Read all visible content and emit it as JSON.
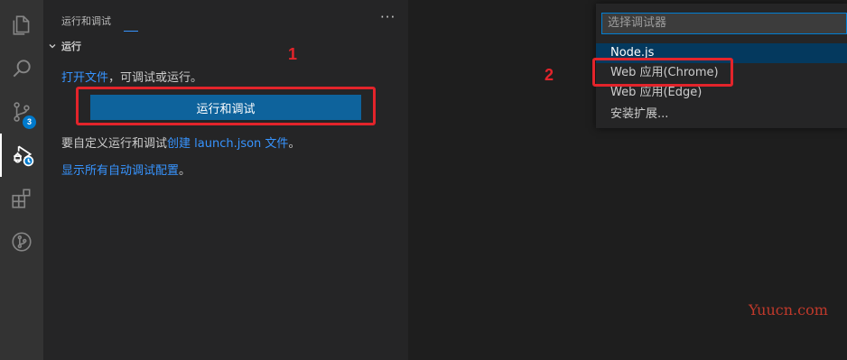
{
  "activity_bar": {
    "items": [
      {
        "icon": "explorer-icon"
      },
      {
        "icon": "search-icon"
      },
      {
        "icon": "source-control-icon",
        "badge": "3"
      },
      {
        "icon": "run-debug-icon"
      },
      {
        "icon": "extensions-icon"
      },
      {
        "icon": "remote-icon"
      }
    ]
  },
  "sidebar": {
    "title": "运行和调试",
    "more": "···",
    "section_title": "运行",
    "open_file_link": "打开文件",
    "open_file_rest": "，可调试或运行。",
    "run_button": "运行和调试",
    "customize_prefix": "要自定义运行和调试",
    "customize_link": "创建 launch.json 文件",
    "customize_suffix": "。",
    "show_all_link": "显示所有自动调试配置",
    "show_all_suffix": "。"
  },
  "quick_pick": {
    "placeholder": "选择调试器",
    "items": [
      {
        "label": "Node.js"
      },
      {
        "label": "Web 应用(Chrome)"
      },
      {
        "label": "Web 应用(Edge)"
      },
      {
        "label": "安装扩展..."
      }
    ]
  },
  "annotations": {
    "step1": "1",
    "step2": "2"
  },
  "watermark": "Yuucn.com",
  "colors": {
    "accent": "#007acc",
    "button": "#0e639c",
    "link": "#3794ff",
    "highlight": "#e3242b"
  }
}
